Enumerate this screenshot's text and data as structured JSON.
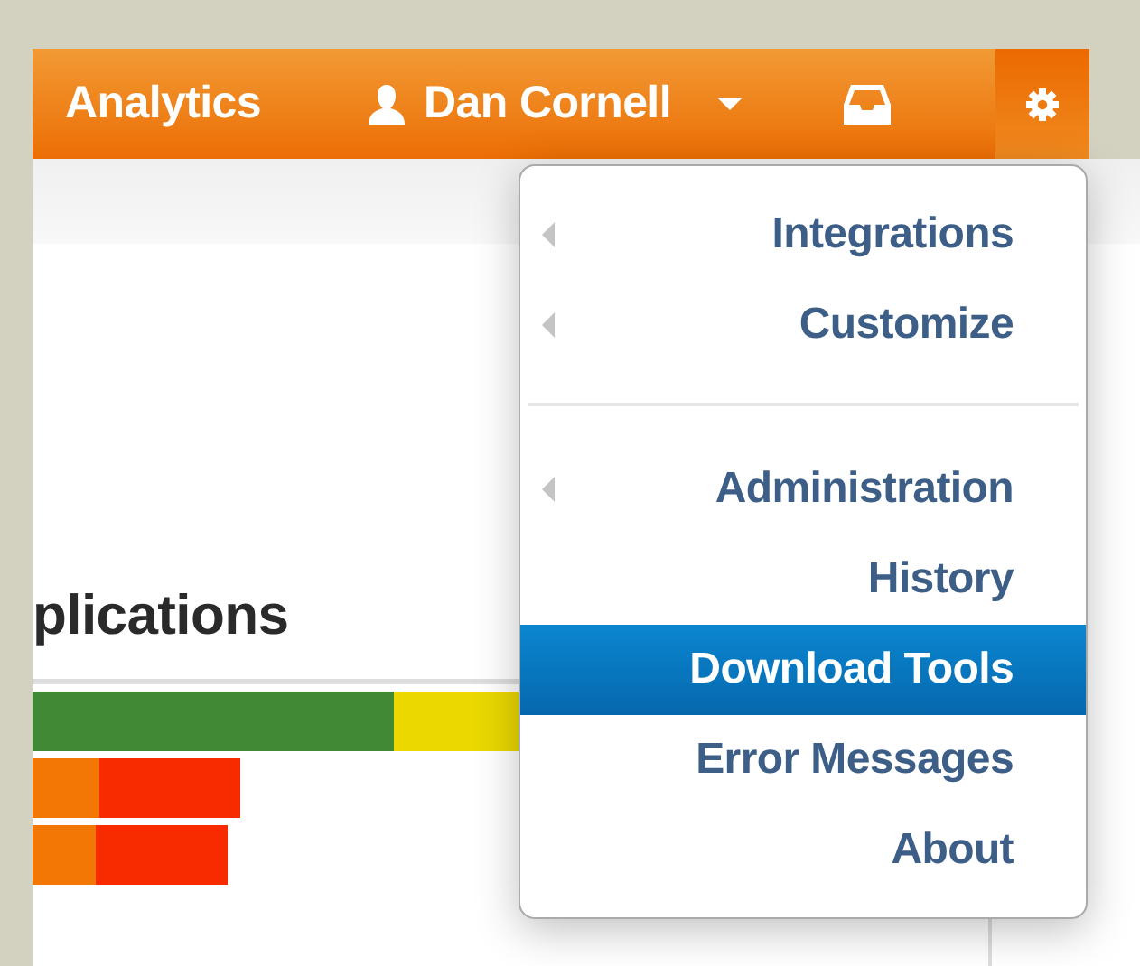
{
  "navbar": {
    "brand": "Analytics",
    "user_name": "Dan Cornell",
    "settings_open": true
  },
  "content": {
    "heading": "plications"
  },
  "menu": {
    "items": [
      {
        "kind": "item",
        "label": "Integrations",
        "submenu": true,
        "selected": false
      },
      {
        "kind": "item",
        "label": "Customize",
        "submenu": true,
        "selected": false
      },
      {
        "kind": "divider"
      },
      {
        "kind": "item",
        "label": "Administration",
        "submenu": true,
        "selected": false
      },
      {
        "kind": "item",
        "label": "History",
        "submenu": false,
        "selected": false
      },
      {
        "kind": "item",
        "label": "Download Tools",
        "submenu": false,
        "selected": true
      },
      {
        "kind": "item",
        "label": "Error Messages",
        "submenu": false,
        "selected": false
      },
      {
        "kind": "item",
        "label": "About",
        "submenu": false,
        "selected": false
      }
    ]
  }
}
